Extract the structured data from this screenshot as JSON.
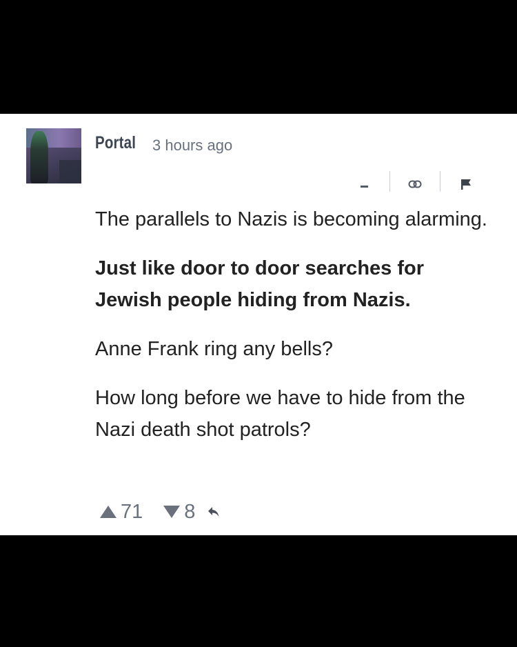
{
  "comment": {
    "author": "Portal",
    "time": "3 hours ago",
    "actions": {
      "collapse_icon": "minus-icon",
      "link_icon": "link-icon",
      "flag_icon": "flag-icon"
    },
    "paragraphs": [
      "The parallels to Nazis is becoming alarming.",
      "Just like door to door searches for Jewish people hiding from Nazis.",
      "Anne Frank ring any bells?",
      "How long before we have to hide from the Nazi death shot patrols?"
    ],
    "upvotes": "71",
    "downvotes": "8",
    "reply_icon": "reply-arrow-icon"
  },
  "colors": {
    "background": "#000000",
    "card": "#ffffff",
    "text": "#222222",
    "muted": "#6b717c"
  }
}
